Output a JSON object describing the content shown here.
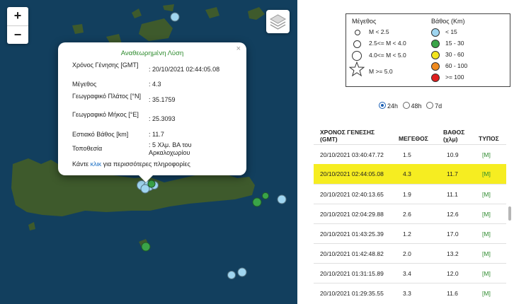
{
  "map": {
    "zoom_in": "+",
    "zoom_out": "−",
    "layers_icon": "layers-icon",
    "colors": {
      "sea": "#123f5e",
      "land": "#3e5a2c",
      "shallow": "#9fd5f0",
      "mid": "#3aa448"
    }
  },
  "popup": {
    "title": "Αναθεωρημένη Λύση",
    "close": "×",
    "rows": [
      {
        "label": "Χρόνος Γένησης [GMT]",
        "value": ": 20/10/2021 02:44:05.08"
      },
      {
        "label": "Μέγεθος",
        "value": ": 4.3"
      },
      {
        "label": "Γεωγραφικό Πλάτος [°N]",
        "value": ": 35.1759"
      },
      {
        "label": "Γεωγραφικό Μήκος [°E]",
        "value": ": 25.3093"
      },
      {
        "label": "Εστιακό Βάθος [km]",
        "value": ": 11.7"
      },
      {
        "label": "Τοποθεσία",
        "value": ": 5 Χλμ. ΒΑ του Αρκαλοχωρίου"
      }
    ],
    "more_prefix": "Κάντε ",
    "more_link": "κλικ",
    "more_suffix": " για περισσότερες πληροφορίες"
  },
  "legend": {
    "magnitude_title": "Μέγεθος",
    "depth_title": "Βάθος (Km)",
    "magnitudes": [
      "M < 2.5",
      "2.5<= M < 4.0",
      "4.0<= M < 5.0",
      "M >= 5.0"
    ],
    "depths": [
      {
        "label": "< 15",
        "color": "#9fd5f0"
      },
      {
        "label": "15 - 30",
        "color": "#3aa448"
      },
      {
        "label": "30 - 60",
        "color": "#f2e41d"
      },
      {
        "label": "60 - 100",
        "color": "#f08a1e"
      },
      {
        "label": ">= 100",
        "color": "#e01e1e"
      }
    ]
  },
  "range": {
    "options": [
      "24h",
      "48h",
      "7d"
    ],
    "selected": "24h"
  },
  "table": {
    "headers": {
      "time": "ΧΡΟΝΟΣ ΓΕΝΕΣΗΣ",
      "time_sub": "(GMT)",
      "mag": "ΜΕΓΕΘΟΣ",
      "depth": "ΒΑΘΟΣ",
      "depth_sub": "(χλμ)",
      "type": "ΤΥΠΟΣ"
    },
    "rows": [
      {
        "time": "20/10/2021 03:40:47.72",
        "mag": "1.5",
        "depth": "10.9",
        "type": "[M]"
      },
      {
        "time": "20/10/2021 02:44:05.08",
        "mag": "4.3",
        "depth": "11.7",
        "type": "[M]"
      },
      {
        "time": "20/10/2021 02:40:13.65",
        "mag": "1.9",
        "depth": "11.1",
        "type": "[M]"
      },
      {
        "time": "20/10/2021 02:04:29.88",
        "mag": "2.6",
        "depth": "12.6",
        "type": "[M]"
      },
      {
        "time": "20/10/2021 01:43:25.39",
        "mag": "1.2",
        "depth": "17.0",
        "type": "[M]"
      },
      {
        "time": "20/10/2021 01:42:48.82",
        "mag": "2.0",
        "depth": "13.2",
        "type": "[M]"
      },
      {
        "time": "20/10/2021 01:31:15.89",
        "mag": "3.4",
        "depth": "12.0",
        "type": "[M]"
      },
      {
        "time": "20/10/2021 01:29:35.55",
        "mag": "3.3",
        "depth": "11.6",
        "type": "[M]"
      }
    ],
    "highlight_color": "#f6ed21"
  }
}
